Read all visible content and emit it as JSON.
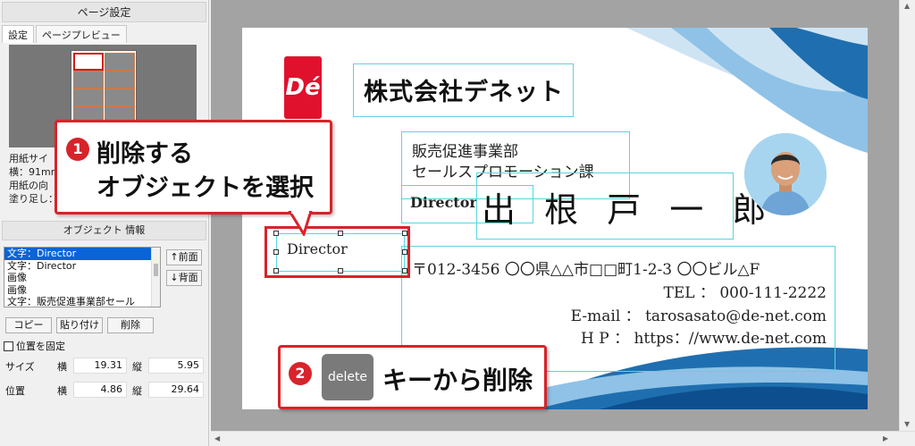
{
  "page_setup": {
    "title": "ページ設定",
    "tabs": [
      "設定",
      "ページプレビュー"
    ],
    "paper_info": [
      "用紙サイ",
      "横：91mm",
      "用紙の向",
      "塗り足し："
    ]
  },
  "object_info": {
    "title": "オブジェクト 情報",
    "items": [
      "文字：Director",
      "文字：Director",
      "画像",
      "画像",
      "文字：販売促進事業部セール"
    ],
    "front_button": "↑前面",
    "back_button": "↓背面",
    "copy_button": "コピー",
    "paste_button": "貼り付け",
    "delete_button": "削除",
    "fix_position_label": "位置を固定",
    "size_label": "サイズ",
    "position_label": "位置",
    "horizontal_label": "横",
    "vertical_label": "縦",
    "size_w": "19.31",
    "size_h": "5.95",
    "pos_x": "4.86",
    "pos_y": "29.64"
  },
  "card": {
    "logo_text": "Dé",
    "company": "株式会社デネット",
    "dept1": "販売促進事業部",
    "dept2": "セールスプロモーション課",
    "title_small": "Director",
    "name": "出 根 戸  一 郎",
    "selected_text": "Director",
    "address": "〒012-3456 〇〇県△△市□□町1-2-3 〇〇ビル△F",
    "tel": "TEL ： 000-111-2222",
    "email": "E-mail ： tarosasato@de-net.com",
    "hp": "H P ： https：//www.de-net.com"
  },
  "callouts": {
    "step1_number": "1",
    "step1_line1": "削除する",
    "step1_line2": "オブジェクトを選択",
    "step2_number": "2",
    "step2_key": "delete",
    "step2_text": "キーから削除"
  },
  "colors": {
    "accent_red": "#d8232a",
    "selection_blue": "#0a64d6",
    "guide_cyan": "#5bd4e0",
    "wave_blue": "#1f6fb0"
  }
}
